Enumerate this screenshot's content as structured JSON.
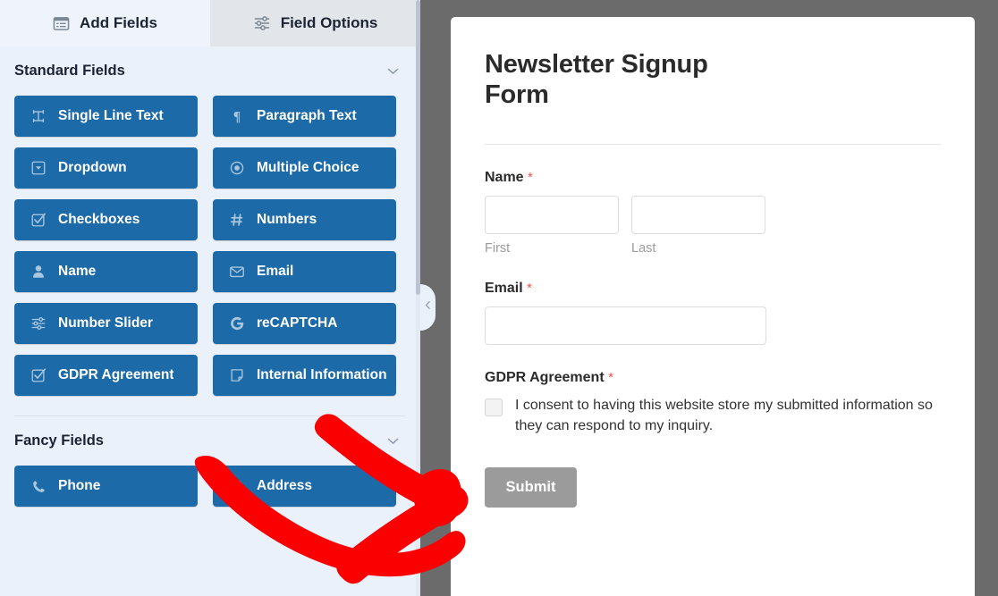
{
  "tabs": [
    {
      "label": "Add Fields",
      "icon": "list-panel-icon",
      "active": true
    },
    {
      "label": "Field Options",
      "icon": "sliders-icon",
      "active": false
    }
  ],
  "sections": [
    {
      "title": "Standard Fields",
      "chevron": "chevron-down-icon",
      "fields": [
        {
          "label": "Single Line Text",
          "icon": "text-width-icon"
        },
        {
          "label": "Paragraph Text",
          "icon": "paragraph-icon"
        },
        {
          "label": "Dropdown",
          "icon": "dropdown-icon"
        },
        {
          "label": "Multiple Choice",
          "icon": "radio-icon"
        },
        {
          "label": "Checkboxes",
          "icon": "checkbox-icon"
        },
        {
          "label": "Numbers",
          "icon": "hash-icon"
        },
        {
          "label": "Name",
          "icon": "user-icon"
        },
        {
          "label": "Email",
          "icon": "envelope-icon"
        },
        {
          "label": "Number Slider",
          "icon": "sliders-icon"
        },
        {
          "label": "reCAPTCHA",
          "icon": "google-g-icon"
        },
        {
          "label": "GDPR Agreement",
          "icon": "checkbox-icon"
        },
        {
          "label": "Internal Information",
          "icon": "note-icon"
        }
      ]
    },
    {
      "title": "Fancy Fields",
      "chevron": "chevron-down-icon",
      "fields": [
        {
          "label": "Phone",
          "icon": "phone-icon"
        },
        {
          "label": "Address",
          "icon": "map-pin-icon"
        }
      ]
    }
  ],
  "collapse_handle": {
    "icon": "chevron-left-icon"
  },
  "preview": {
    "title": "Newsletter Signup Form",
    "required_marker": "*",
    "name_field": {
      "label": "Name",
      "required": true,
      "sub_labels": [
        "First",
        "Last"
      ],
      "values": [
        "",
        ""
      ]
    },
    "email_field": {
      "label": "Email",
      "required": true,
      "value": ""
    },
    "gdpr_field": {
      "label": "GDPR Agreement",
      "required": true,
      "consent_text": "I consent to having this website store my submitted information so they can respond to my inquiry.",
      "checked": false
    },
    "submit_label": "Submit"
  },
  "colors": {
    "field_button_blue": "#1c6aa8",
    "panel_background": "#eaf1fb",
    "divider_gray": "#6b6b6b",
    "required_red": "#e5554e",
    "submit_gray": "#9b9b9b",
    "annotation_red": "#fa0000"
  }
}
